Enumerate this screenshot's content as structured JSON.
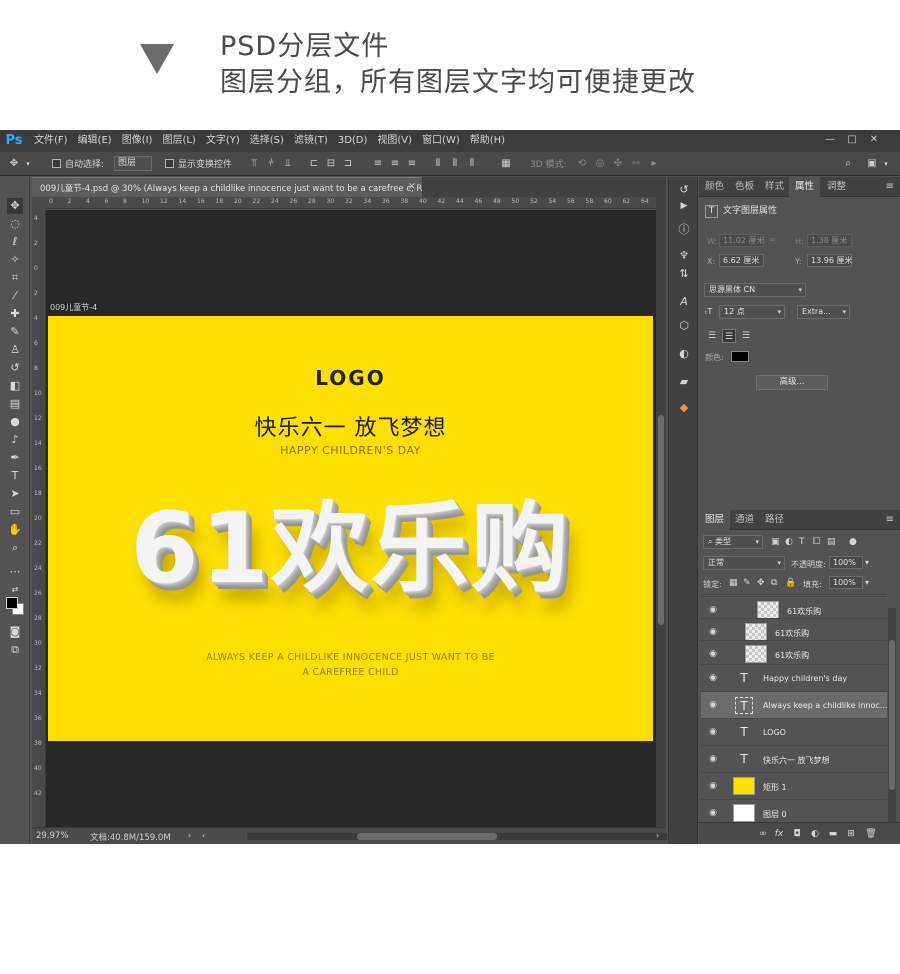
{
  "header": {
    "line1": "PSD分层文件",
    "line2": "图层分组，所有图层文字均可便捷更改"
  },
  "app": {
    "logo": "Ps",
    "menu": [
      "文件(F)",
      "编辑(E)",
      "图像(I)",
      "图层(L)",
      "文字(Y)",
      "选择(S)",
      "滤镜(T)",
      "3D(D)",
      "视图(V)",
      "窗口(W)",
      "帮助(H)"
    ],
    "window_controls": [
      "—",
      "□",
      "✕"
    ],
    "options": {
      "auto_select_label": "自动选择:",
      "auto_select_value": "图层",
      "show_transform_label": "显示变换控件",
      "mode_3d_label": "3D 模式:"
    }
  },
  "document": {
    "tab_title": "009儿童节-4.psd @ 30% (Always keep a childlike innocence just want to be  a carefree c, RGB/8)",
    "tab_close": "×",
    "artboard_label": "009儿童节-4",
    "ruler_h_numbers": [
      "0",
      "2",
      "4",
      "6",
      "8",
      "10",
      "12",
      "14",
      "16",
      "18",
      "20",
      "22",
      "24",
      "26",
      "28",
      "30",
      "32",
      "34",
      "36",
      "38",
      "40",
      "42",
      "44",
      "46",
      "48",
      "50",
      "52",
      "54",
      "56",
      "58",
      "60",
      "62",
      "64"
    ],
    "ruler_v_numbers": [
      "4",
      "2",
      "0",
      "2",
      "4",
      "6",
      "8",
      "10",
      "12",
      "14",
      "16",
      "18",
      "20",
      "22",
      "24",
      "26",
      "28",
      "30",
      "32",
      "34",
      "36",
      "38",
      "40",
      "42"
    ],
    "zoom": "29.97%",
    "doc_size": "文档:40.8M/159.0M"
  },
  "canvas": {
    "background": "#ffe000",
    "logo": "LOGO",
    "slogan": "快乐六一  放飞梦想",
    "subtitle": "HAPPY CHILDREN'S DAY",
    "headline": "61欢乐购",
    "tagline1": "ALWAYS KEEP A CHILDLIKE INNOCENCE JUST WANT TO BE",
    "tagline2": "A CAREFREE CHILD"
  },
  "properties_panel": {
    "tabs": [
      "颜色",
      "色板",
      "样式",
      "属性",
      "调整"
    ],
    "active_tab": "属性",
    "title": "文字图层属性",
    "w_label": "W:",
    "w_value": "11.02 厘米",
    "h_label": "H:",
    "h_value": "1.38 厘米",
    "x_label": "X:",
    "x_value": "6.62 厘米",
    "y_label": "Y:",
    "y_value": "13.96 厘米",
    "font": "思源黑体 CN",
    "font_size": "12 点",
    "font_weight": "Extra...",
    "color_label": "颜色:",
    "advanced_button": "高级..."
  },
  "layers_panel": {
    "tabs": [
      "图层",
      "通道",
      "路径"
    ],
    "active_tab": "图层",
    "filter_label": "类型",
    "blend_mode": "正常",
    "opacity_label": "不透明度:",
    "opacity_value": "100%",
    "lock_label": "锁定:",
    "fill_label": "填充:",
    "fill_value": "100%",
    "layers": [
      {
        "name": "61欢乐购",
        "kind": "pixel"
      },
      {
        "name": "61欢乐购",
        "kind": "pixel"
      },
      {
        "name": "61欢乐购",
        "kind": "pixel"
      },
      {
        "name": "Happy children's day",
        "kind": "text"
      },
      {
        "name": "Always keep a childlike innoc...",
        "kind": "text"
      },
      {
        "name": "LOGO",
        "kind": "text"
      },
      {
        "name": "快乐六一  放飞梦想",
        "kind": "text"
      },
      {
        "name": "矩形 1",
        "kind": "shape"
      },
      {
        "name": "图层 0",
        "kind": "background"
      }
    ],
    "bottom_icons": [
      "link-icon",
      "fx-icon",
      "mask-icon",
      "adjustment-icon",
      "group-icon",
      "new-layer-icon",
      "trash-icon"
    ]
  }
}
